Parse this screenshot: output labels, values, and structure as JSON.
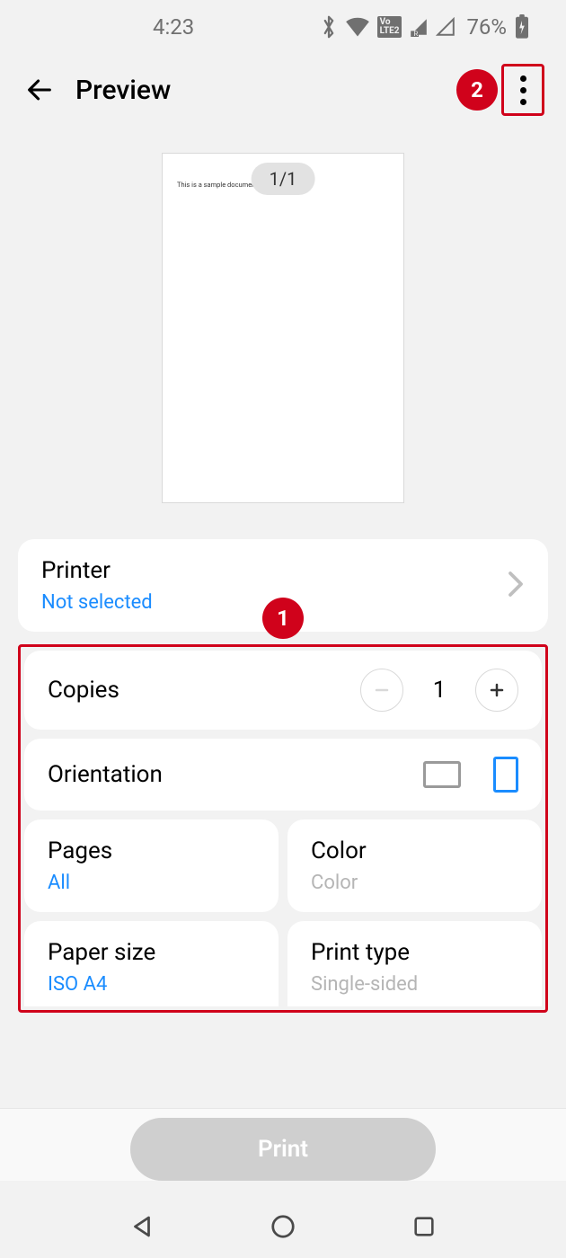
{
  "status": {
    "time": "4:23",
    "battery": "76%"
  },
  "header": {
    "title": "Preview"
  },
  "callouts": {
    "one": "1",
    "two": "2"
  },
  "preview": {
    "doc_text": "This is a sample document.",
    "page_indicator": "1/1"
  },
  "printer": {
    "label": "Printer",
    "value": "Not selected"
  },
  "copies": {
    "label": "Copies",
    "value": "1"
  },
  "orientation": {
    "label": "Orientation"
  },
  "pages": {
    "label": "Pages",
    "value": "All"
  },
  "color": {
    "label": "Color",
    "value": "Color"
  },
  "paper": {
    "label": "Paper size",
    "value": "ISO A4"
  },
  "print_type": {
    "label": "Print type",
    "value": "Single-sided"
  },
  "actions": {
    "print": "Print"
  }
}
